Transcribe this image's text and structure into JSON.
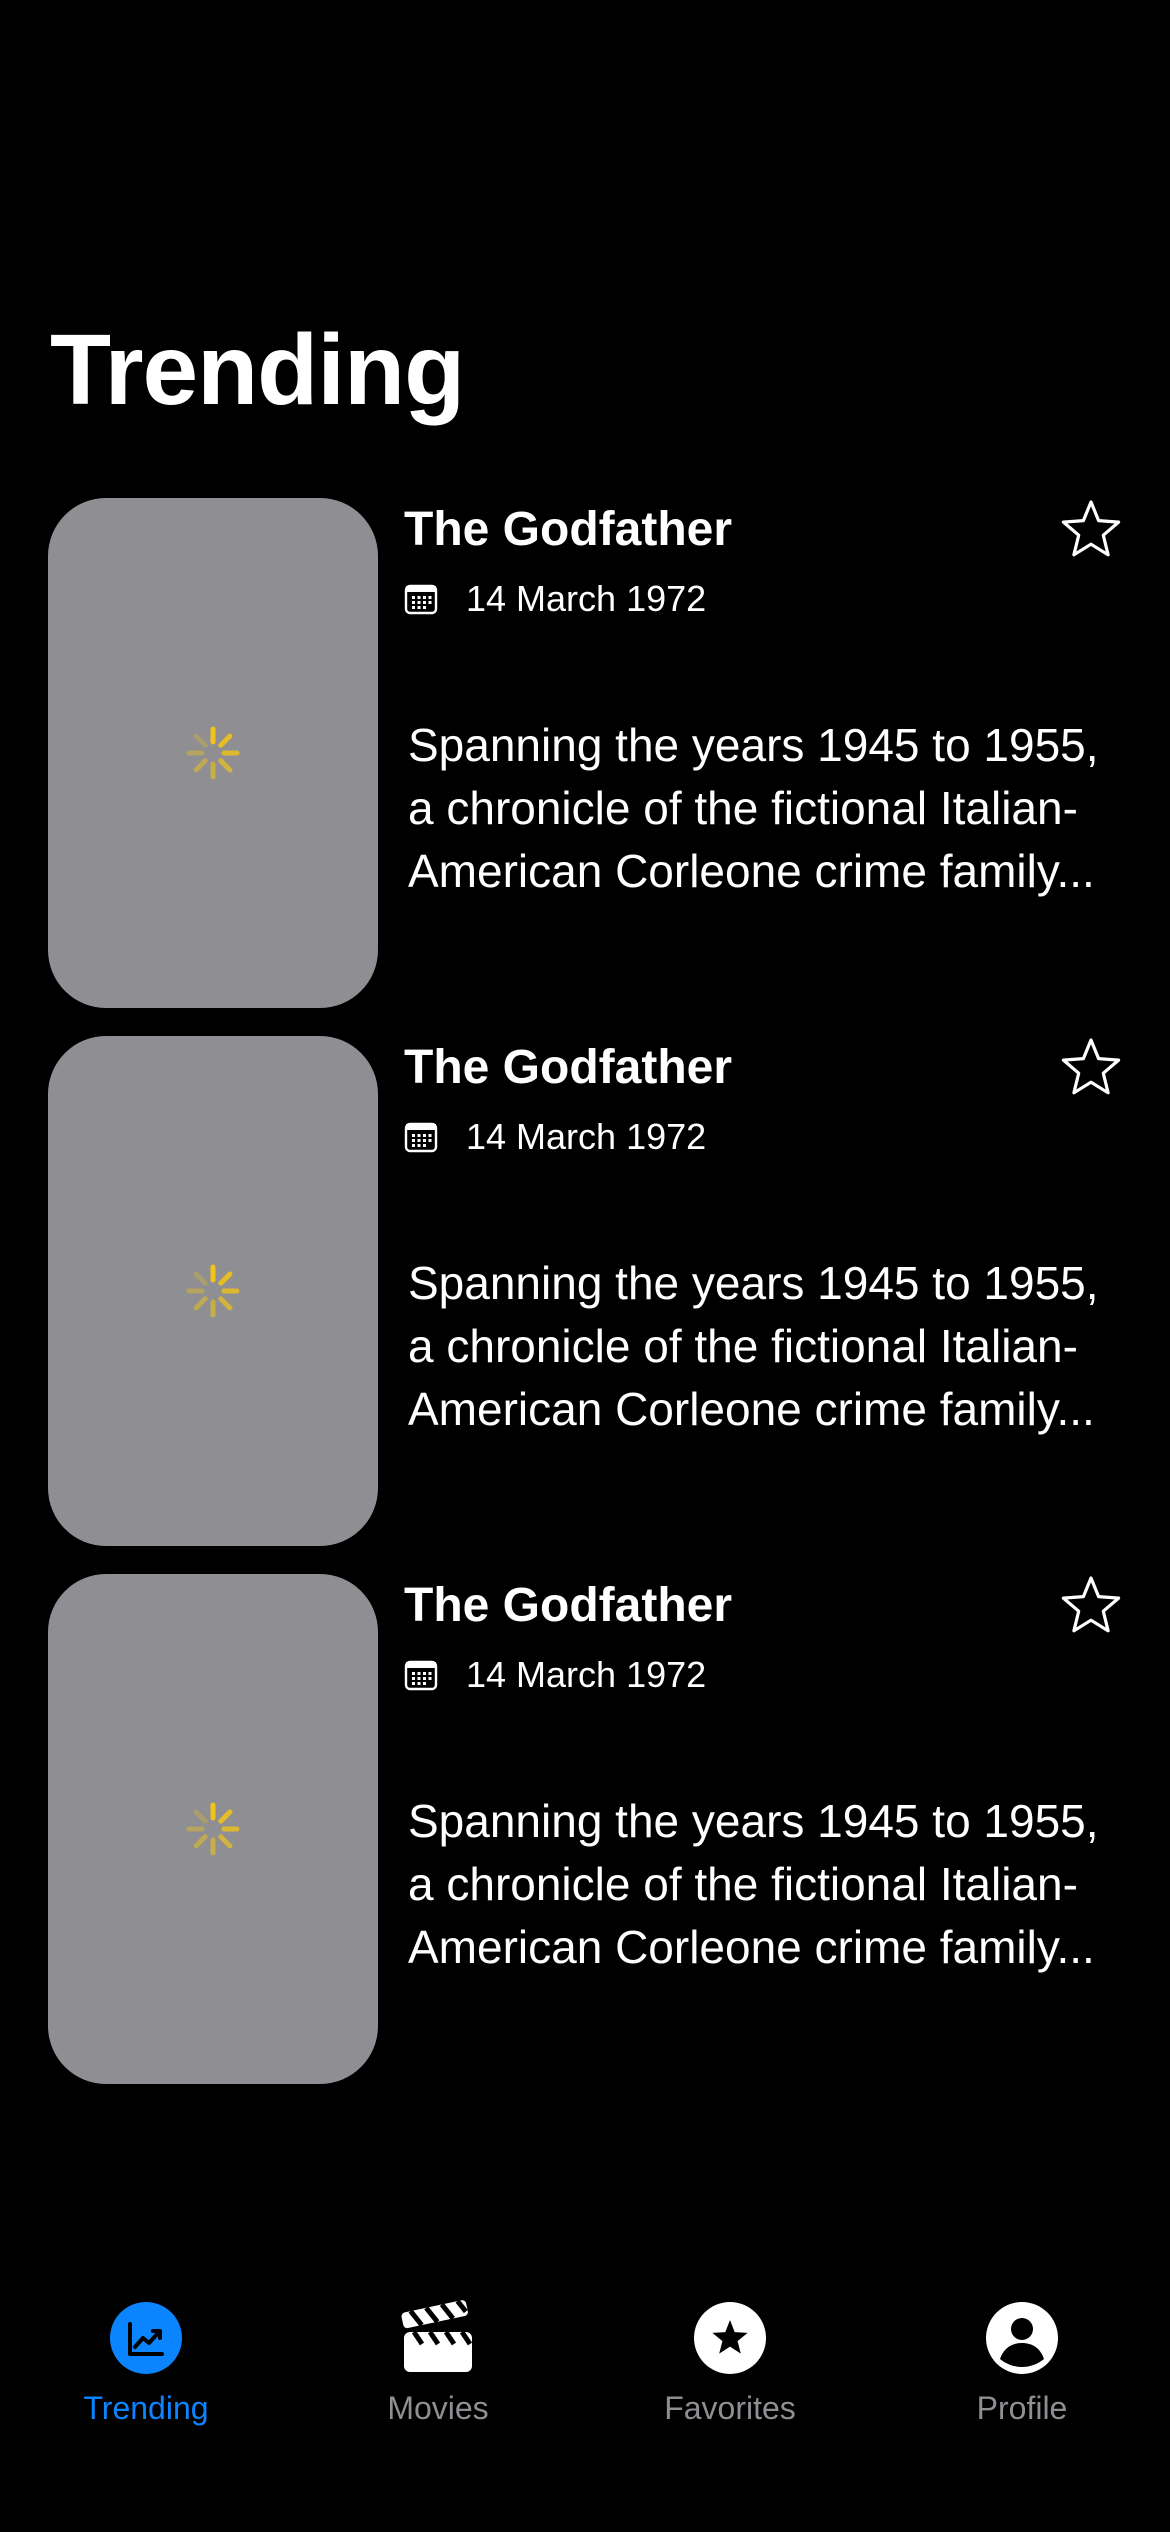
{
  "page": {
    "title": "Trending"
  },
  "colors": {
    "accent": "#0a84ff",
    "placeholder": "#8e8e93",
    "spinner": "#f0c419",
    "tab_inactive": "#8e8e93"
  },
  "movies": [
    {
      "title": "The Godfather",
      "release_date": "14 March 1972",
      "overview": "Spanning the years 1945 to 1955, a chronicle of the fictional Italian-American Corleone crime family...",
      "favorite_icon": "star-outline-icon"
    },
    {
      "title": "The Godfather",
      "release_date": "14 March 1972",
      "overview": "Spanning the years 1945 to 1955, a chronicle of the fictional Italian-American Corleone crime family...",
      "favorite_icon": "star-outline-icon"
    },
    {
      "title": "The Godfather",
      "release_date": "14 March 1972",
      "overview": "Spanning the years 1945 to 1955, a chronicle of the fictional Italian-American Corleone crime family...",
      "favorite_icon": "star-outline-icon"
    }
  ],
  "tabbar": {
    "tabs": [
      {
        "label": "Trending",
        "icon": "trending-chart-icon",
        "active": true
      },
      {
        "label": "Movies",
        "icon": "clapperboard-icon",
        "active": false
      },
      {
        "label": "Favorites",
        "icon": "star-circle-icon",
        "active": false
      },
      {
        "label": "Profile",
        "icon": "person-circle-icon",
        "active": false
      }
    ]
  }
}
